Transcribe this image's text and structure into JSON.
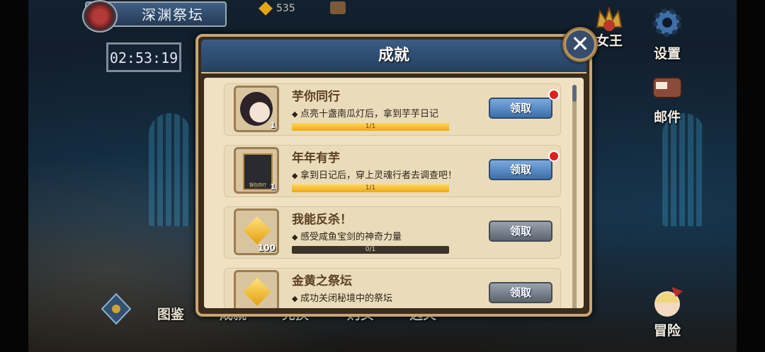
{
  "hud": {
    "location": "深渊祭坛",
    "timer": "02:53:19",
    "gems": "535"
  },
  "side_menu": {
    "queen": "女王",
    "settings": "设置",
    "mail": "邮件",
    "adventure": "冒险"
  },
  "bottom_menu": {
    "codex": "图鉴",
    "achievement": "成就",
    "exchange": "兑换",
    "shop": "购买",
    "select": "选关"
  },
  "dialog": {
    "title": "成就",
    "close": "✕",
    "items": [
      {
        "name": "芋你同行",
        "desc": "点亮十盏南瓜灯后，拿到芋芋日记",
        "progress": "1/1",
        "fraction": 1.0,
        "qty": "1",
        "button": "领取",
        "has_dot": true,
        "enabled": true
      },
      {
        "name": "年年有芋",
        "desc": "拿到日记后，穿上灵魂行者去调查吧！",
        "progress": "1/1",
        "fraction": 1.0,
        "qty": "1",
        "button": "领取",
        "has_dot": true,
        "enabled": true,
        "card_caption": "锅包肉行"
      },
      {
        "name": "我能反杀！",
        "desc": "感受咸鱼宝剑的神奇力量",
        "progress": "0/1",
        "fraction": 0.0,
        "qty": "100",
        "button": "领取",
        "has_dot": false,
        "enabled": false
      },
      {
        "name": "金黄之祭坛",
        "desc": "成功关闭秘境中的祭坛",
        "progress": "",
        "fraction": 0.0,
        "qty": "",
        "button": "领取",
        "has_dot": false,
        "enabled": false
      }
    ]
  }
}
